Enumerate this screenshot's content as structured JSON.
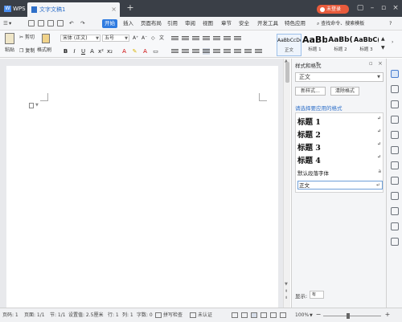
{
  "titlebar": {
    "app_label": "WPS",
    "doc_tab": "文字文稿1",
    "new_tab": "+",
    "login_label": "未登录"
  },
  "menu": {
    "items": [
      "开始",
      "插入",
      "页面布局",
      "引用",
      "审阅",
      "视图",
      "章节",
      "安全",
      "开发工具",
      "特色应用"
    ],
    "active": "开始",
    "search_label": "查找命令、搜索模板",
    "help": "?"
  },
  "ribbon": {
    "paste": "粘贴",
    "cut": "剪切",
    "copy": "复制",
    "format_painter": "格式刷",
    "font_name": "宋体 (正文)",
    "font_size": "五号",
    "bold": "B",
    "italic": "I",
    "underline": "U",
    "styles": [
      {
        "sample": "AaBbCcDd",
        "caption": "正文"
      },
      {
        "sample": "AaBb",
        "caption": "标题 1"
      },
      {
        "sample": "AaBb(",
        "caption": "标题 2"
      },
      {
        "sample": "AaBbC(",
        "caption": "标题 3"
      }
    ]
  },
  "pane": {
    "title": "样式和格式",
    "current_style": "正文",
    "new_style_btn": "新样式...",
    "clear_format_btn": "清除格式",
    "hint": "请选择要应用的格式",
    "styles": [
      {
        "label": "标题  1",
        "kind": "h"
      },
      {
        "label": "标题  2",
        "kind": "h"
      },
      {
        "label": "标题  3",
        "kind": "h"
      },
      {
        "label": "标题  4",
        "kind": "h"
      },
      {
        "label": "默认段落字体",
        "kind": "sm"
      },
      {
        "label": "正文",
        "kind": "sel"
      }
    ],
    "return_mark": "↵",
    "show_label": "显示:",
    "show_value": "有"
  },
  "status": {
    "page_num": "页码: 1",
    "pages": "页面: 1/1",
    "section": "节: 1/1",
    "setting": "设置值: 2.5厘米",
    "row": "行: 1",
    "col": "列: 1",
    "words": "字数: 0",
    "spell": "拼写检查",
    "unverified": "未认证",
    "zoom": "100%",
    "zoom_minus": "−",
    "zoom_plus": "+"
  }
}
